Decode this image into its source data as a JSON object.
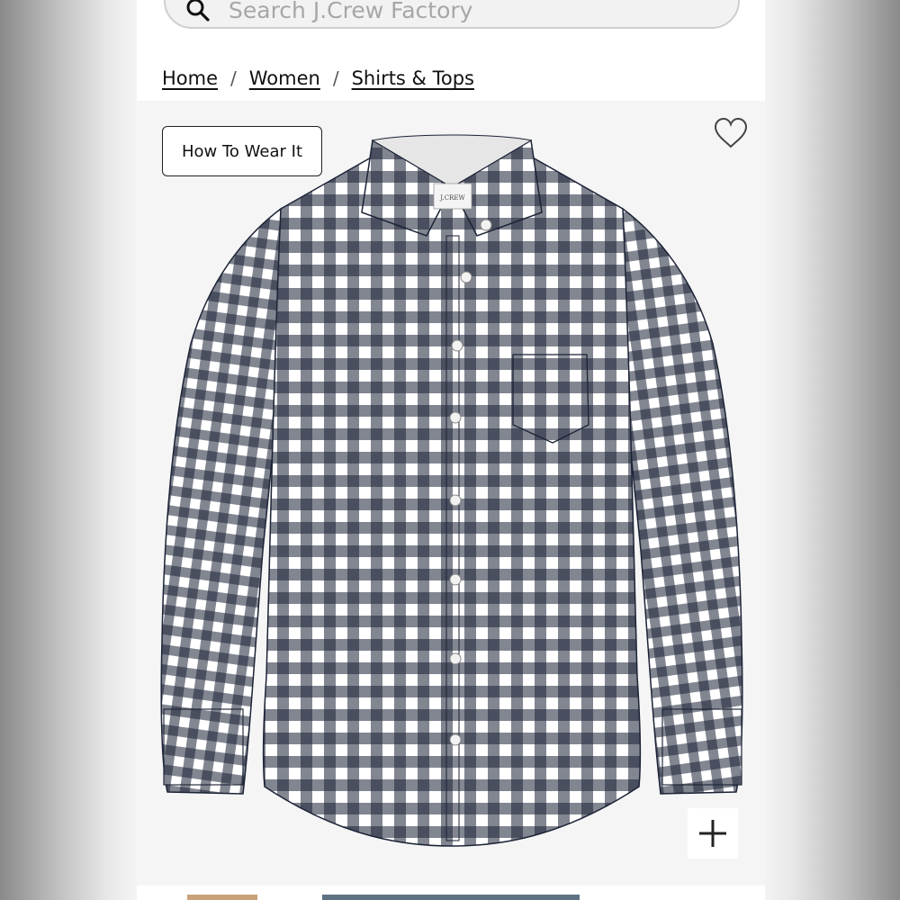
{
  "search": {
    "placeholder": "Search J.Crew Factory",
    "icon": "search-icon"
  },
  "breadcrumb": {
    "items": [
      "Home",
      "Women",
      "Shirts & Tops"
    ],
    "separator": "/"
  },
  "product": {
    "how_to_wear_label": "How To Wear It",
    "label_text": "J.CREW",
    "pattern_colors": {
      "navy": "#1c2336",
      "white": "#ffffff",
      "mid": "#7c8090"
    },
    "icons": {
      "favorite": "heart-icon",
      "zoom": "plus-icon"
    }
  }
}
